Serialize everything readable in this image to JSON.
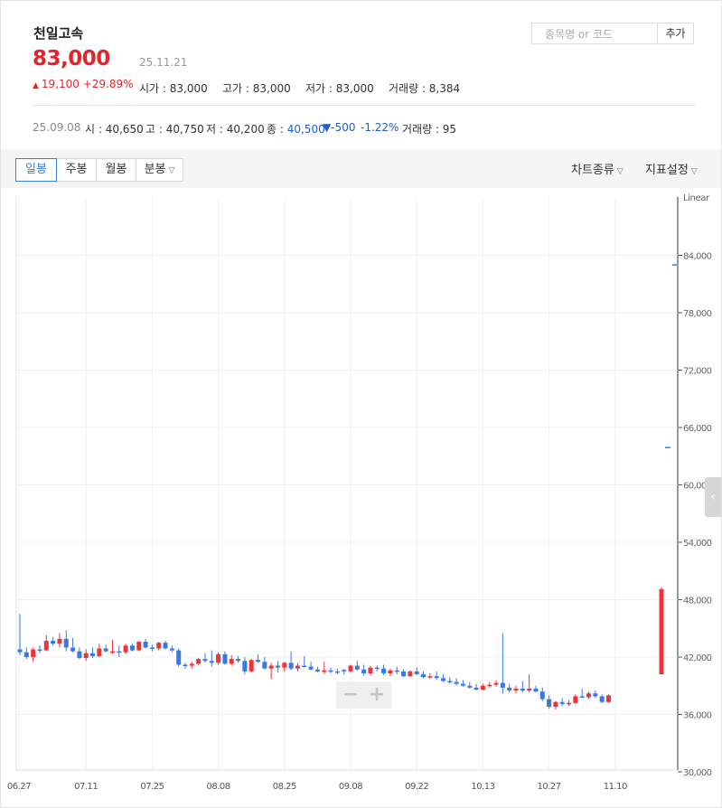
{
  "stock": {
    "name": "천일고속",
    "price": "83,000",
    "date": "25.11.21",
    "change": "19,100",
    "change_pct": "+29.89%",
    "summary": {
      "open_label": "시가",
      "open": "83,000",
      "high_label": "고가",
      "high": "83,000",
      "low_label": "저가",
      "low": "83,000",
      "volume_label": "거래량",
      "volume": "8,384"
    }
  },
  "search": {
    "placeholder": "종목명 or 코드",
    "add_label": "추가"
  },
  "detail": {
    "date": "25.09.08",
    "open_label": "시",
    "open": "40,650",
    "high_label": "고",
    "high": "40,750",
    "low_label": "저",
    "low": "40,200",
    "close_label": "종",
    "close": "40,500",
    "change": "▼-500",
    "change_pct": "-1.22%",
    "volume_label": "거래량",
    "volume": "95"
  },
  "toolbar": {
    "periods": [
      "일봉",
      "주봉",
      "월봉",
      "분봉"
    ],
    "active_period": "일봉",
    "chart_type_label": "차트종류",
    "indicator_label": "지표설정"
  },
  "colors": {
    "up": "#f0323f",
    "down": "#3a79e1",
    "accent": "#3b7fd5"
  },
  "icons": [
    "up-triangle-icon",
    "down-triangle-icon",
    "chevron-down-icon",
    "chevron-left-icon",
    "minus-icon",
    "plus-icon"
  ],
  "chart_data": {
    "type": "candlestick",
    "scale_label": "Linear",
    "ylim": [
      30000,
      90000
    ],
    "y_ticks": [
      30000,
      36000,
      42000,
      48000,
      54000,
      60000,
      66000,
      72000,
      78000,
      84000
    ],
    "y_tick_labels": [
      "30,000",
      "36,000",
      "42,000",
      "48,000",
      "54,000",
      "60,000",
      "66,000",
      "72,000",
      "78,000",
      "84,000"
    ],
    "x_tick_labels": [
      "06.27",
      "07.11",
      "07.25",
      "08.08",
      "08.25",
      "09.08",
      "09.22",
      "10.13",
      "10.27",
      "11.10"
    ],
    "x_tick_index": [
      0,
      10,
      20,
      30,
      40,
      50,
      60,
      70,
      80,
      90
    ],
    "candles": [
      [
        42800,
        46500,
        42200,
        42500
      ],
      [
        42500,
        43000,
        41800,
        42000
      ],
      [
        42000,
        43000,
        41500,
        42800
      ],
      [
        42800,
        43200,
        42400,
        42700
      ],
      [
        42700,
        44300,
        42600,
        43700
      ],
      [
        43700,
        44100,
        43200,
        43400
      ],
      [
        43400,
        44500,
        43000,
        43900
      ],
      [
        43900,
        44800,
        42600,
        43000
      ],
      [
        43000,
        44000,
        42500,
        42600
      ],
      [
        42600,
        43000,
        41800,
        41900
      ],
      [
        41900,
        42800,
        41600,
        42400
      ],
      [
        42400,
        43000,
        41900,
        42100
      ],
      [
        42100,
        43400,
        42000,
        42900
      ],
      [
        42900,
        43300,
        42500,
        42600
      ],
      [
        42600,
        43800,
        42300,
        42600
      ],
      [
        42600,
        43200,
        42000,
        42500
      ],
      [
        42500,
        43400,
        42300,
        43200
      ],
      [
        43200,
        43400,
        42600,
        42700
      ],
      [
        42700,
        43700,
        42600,
        43600
      ],
      [
        43600,
        43900,
        42900,
        43000
      ],
      [
        43000,
        43300,
        42600,
        42900
      ],
      [
        42900,
        43600,
        42700,
        43500
      ],
      [
        43500,
        43700,
        42800,
        42900
      ],
      [
        42900,
        43200,
        42500,
        42700
      ],
      [
        42700,
        42900,
        41000,
        41200
      ],
      [
        41200,
        41400,
        40800,
        41100
      ],
      [
        41100,
        41500,
        40800,
        41300
      ],
      [
        41300,
        41900,
        41100,
        41800
      ],
      [
        41800,
        42400,
        41400,
        41600
      ],
      [
        41600,
        42700,
        41000,
        41400
      ],
      [
        41400,
        42500,
        41200,
        42300
      ],
      [
        42300,
        42600,
        41200,
        41300
      ],
      [
        41300,
        42200,
        41100,
        41800
      ],
      [
        41800,
        42100,
        41400,
        41600
      ],
      [
        41600,
        42000,
        40200,
        40500
      ],
      [
        40500,
        41800,
        40400,
        41700
      ],
      [
        41700,
        42300,
        41400,
        41500
      ],
      [
        41500,
        42000,
        40700,
        40800
      ],
      [
        40800,
        41400,
        39700,
        41100
      ],
      [
        41100,
        41600,
        40400,
        40900
      ],
      [
        40900,
        41500,
        40500,
        41400
      ],
      [
        41400,
        42600,
        40600,
        40800
      ],
      [
        40800,
        41400,
        40500,
        41100
      ],
      [
        41100,
        42100,
        40900,
        41000
      ],
      [
        41000,
        41500,
        40600,
        40700
      ],
      [
        40700,
        41000,
        40400,
        40500
      ],
      [
        40500,
        41500,
        40300,
        40600
      ],
      [
        40600,
        40900,
        40300,
        40500
      ],
      [
        40500,
        40800,
        40200,
        40350
      ],
      [
        40650,
        40750,
        40200,
        40500
      ],
      [
        40500,
        41200,
        40400,
        41100
      ],
      [
        41100,
        41600,
        40600,
        40700
      ],
      [
        40700,
        41200,
        40100,
        40300
      ],
      [
        40300,
        41100,
        40100,
        40900
      ],
      [
        40900,
        41100,
        40500,
        40800
      ],
      [
        40800,
        41200,
        40100,
        40300
      ],
      [
        40300,
        40800,
        40000,
        40600
      ],
      [
        40600,
        41000,
        40200,
        40500
      ],
      [
        40500,
        40700,
        39900,
        40000
      ],
      [
        40000,
        40600,
        39900,
        40500
      ],
      [
        40500,
        40900,
        40100,
        40200
      ],
      [
        40200,
        40500,
        39800,
        39900
      ],
      [
        39900,
        40300,
        39700,
        40000
      ],
      [
        40000,
        40500,
        39600,
        39800
      ],
      [
        39800,
        40200,
        39400,
        39500
      ],
      [
        39500,
        39900,
        39200,
        39400
      ],
      [
        39400,
        39800,
        39000,
        39200
      ],
      [
        39200,
        39600,
        38900,
        39000
      ],
      [
        39000,
        39400,
        38700,
        38800
      ],
      [
        38800,
        39200,
        38500,
        38600
      ],
      [
        38600,
        39200,
        38500,
        39000
      ],
      [
        39000,
        39400,
        38800,
        39100
      ],
      [
        39100,
        39600,
        38900,
        39300
      ],
      [
        39300,
        44500,
        38200,
        38800
      ],
      [
        38800,
        39200,
        38300,
        38500
      ],
      [
        38500,
        39000,
        38200,
        38700
      ],
      [
        38700,
        39500,
        38300,
        38500
      ],
      [
        38500,
        40200,
        38300,
        38700
      ],
      [
        38700,
        39000,
        38300,
        38400
      ],
      [
        38400,
        38800,
        37400,
        37600
      ],
      [
        37600,
        38000,
        36600,
        36800
      ],
      [
        36800,
        37400,
        36500,
        37300
      ],
      [
        37300,
        37700,
        36900,
        37100
      ],
      [
        37100,
        37500,
        36900,
        37200
      ],
      [
        37200,
        38100,
        37100,
        37900
      ],
      [
        37900,
        38700,
        37700,
        37800
      ],
      [
        37800,
        38400,
        37600,
        38200
      ],
      [
        38200,
        38500,
        37700,
        37900
      ],
      [
        37900,
        38100,
        37200,
        37300
      ],
      [
        37300,
        38100,
        37200,
        38000
      ]
    ],
    "last_candle": [
      40200,
      49300,
      40200,
      49100
    ],
    "marker_values": [
      83000,
      63900
    ]
  }
}
